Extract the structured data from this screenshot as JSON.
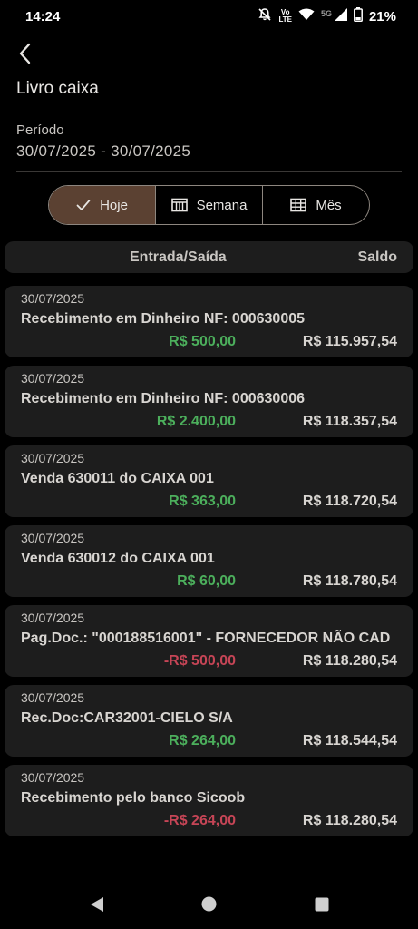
{
  "status_bar": {
    "time": "14:24",
    "volte_top": "Vo",
    "volte_bottom": "LTE",
    "network": "5G",
    "battery": "21%",
    "icons": [
      "notifications-off-icon",
      "volte-icon",
      "wifi-icon",
      "signal-icon",
      "battery-icon"
    ]
  },
  "header": {
    "back_icon": "back-arrow-icon",
    "title": "Livro caixa"
  },
  "period": {
    "label": "Período",
    "value": "30/07/2025 - 30/07/2025"
  },
  "segments": [
    {
      "label": "Hoje",
      "icon": "check-icon",
      "active": true
    },
    {
      "label": "Semana",
      "icon": "calendar-week-icon",
      "active": false
    },
    {
      "label": "Mês",
      "icon": "calendar-month-icon",
      "active": false
    }
  ],
  "table_header": {
    "entry_label": "Entrada/Saída",
    "balance_label": "Saldo"
  },
  "transactions": [
    {
      "date": "30/07/2025",
      "description": "Recebimento em Dinheiro NF: 000630005",
      "amount": "R$ 500,00",
      "type": "in",
      "balance": "R$ 115.957,54"
    },
    {
      "date": "30/07/2025",
      "description": "Recebimento em Dinheiro NF: 000630006",
      "amount": "R$ 2.400,00",
      "type": "in",
      "balance": "R$ 118.357,54"
    },
    {
      "date": "30/07/2025",
      "description": "Venda 630011 do CAIXA 001",
      "amount": "R$ 363,00",
      "type": "in",
      "balance": "R$ 118.720,54"
    },
    {
      "date": "30/07/2025",
      "description": "Venda 630012 do CAIXA 001",
      "amount": "R$ 60,00",
      "type": "in",
      "balance": "R$ 118.780,54"
    },
    {
      "date": "30/07/2025",
      "description": "Pag.Doc.: \"000188516001\" - FORNECEDOR NÃO CAD",
      "amount": "-R$ 500,00",
      "type": "out",
      "balance": "R$ 118.280,54"
    },
    {
      "date": "30/07/2025",
      "description": "Rec.Doc:CAR32001-CIELO S/A",
      "amount": "R$ 264,00",
      "type": "in",
      "balance": "R$ 118.544,54"
    },
    {
      "date": "30/07/2025",
      "description": "Recebimento pelo banco Sicoob",
      "amount": "-R$ 264,00",
      "type": "out",
      "balance": "R$ 118.280,54"
    }
  ],
  "colors": {
    "background": "#000000",
    "card": "#1d1d1d",
    "income": "#4caf5c",
    "expense": "#c64556",
    "segment_active": "#5b4132"
  },
  "nav_bar": {
    "icons": [
      "nav-back-icon",
      "nav-home-icon",
      "nav-recents-icon"
    ]
  }
}
